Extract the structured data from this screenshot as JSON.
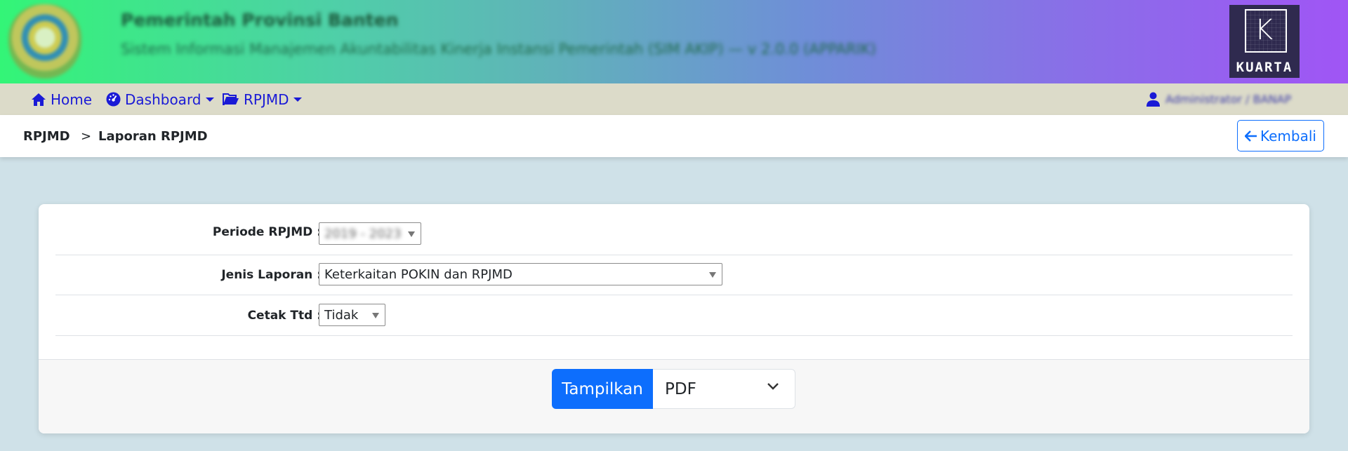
{
  "header": {
    "org_title": "Pemerintah Provinsi Banten",
    "org_subtitle": "Sistem Informasi Manajemen Akuntabilitas Kinerja Instansi Pemerintah (SIM AKIP) — v 2.0.0 (APPARIK)",
    "brand_logo_text": "KUARTA",
    "brand_mark": "K"
  },
  "nav": {
    "home_label": "Home",
    "dashboard_label": "Dashboard",
    "rpjmd_label": "RPJMD",
    "user_label": "Administrator / BANAP"
  },
  "breadcrumb": {
    "root": "RPJMD",
    "separator": ">",
    "current": "Laporan RPJMD",
    "back_label": "Kembali"
  },
  "form": {
    "periode_label": "Periode RPJMD :",
    "periode_value": "2019 - 2023",
    "jenis_label": "Jenis Laporan :",
    "jenis_value": "Keterkaitan POKIN dan RPJMD",
    "cetak_label": "Cetak Ttd :",
    "cetak_value": "Tidak"
  },
  "footer": {
    "show_button": "Tampilkan",
    "format_value": "PDF"
  },
  "colors": {
    "primary": "#0d6efd",
    "nav_link": "#1a1ad6",
    "nav_bg": "#dcdbc9",
    "page_bg": "#cfe1e8"
  }
}
